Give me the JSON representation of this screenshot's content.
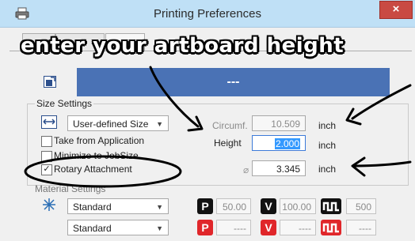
{
  "window": {
    "title": "Printing Preferences",
    "close_label": "×"
  },
  "annotation": {
    "caption": "enter your artboard height"
  },
  "preview": {
    "label": "---"
  },
  "size_settings": {
    "legend": "Size Settings",
    "size_select": {
      "value": "User-defined Size"
    },
    "take_from_application": {
      "label": "Take from Application",
      "checked": false
    },
    "minimize_to_jobsize": {
      "label": "Minimize to JobSize",
      "checked": false
    },
    "rotary_attachment": {
      "label": "Rotary Attachment",
      "checked": true
    },
    "circumference": {
      "label": "Circumf.",
      "value": "10.509",
      "unit": "inch"
    },
    "height": {
      "label": "Height",
      "value": "2.000",
      "unit": "inch"
    },
    "diameter": {
      "symbol": "⌀",
      "value": "3.345",
      "unit": "inch"
    }
  },
  "material_settings": {
    "legend": "Material Settings",
    "row1": {
      "select": "Standard",
      "p_badge": "P",
      "p_value": "50.00",
      "v_badge": "V",
      "v_value": "100.00",
      "w_value": "500"
    },
    "row2": {
      "select": "Standard",
      "p_badge": "P",
      "p_value": "----",
      "v_badge": "V",
      "v_value": "----",
      "w_value": "----"
    }
  },
  "colors": {
    "accent_blue": "#4a72b5",
    "badge_red": "#e0262a",
    "badge_black": "#111111",
    "close_red": "#c94a43"
  }
}
